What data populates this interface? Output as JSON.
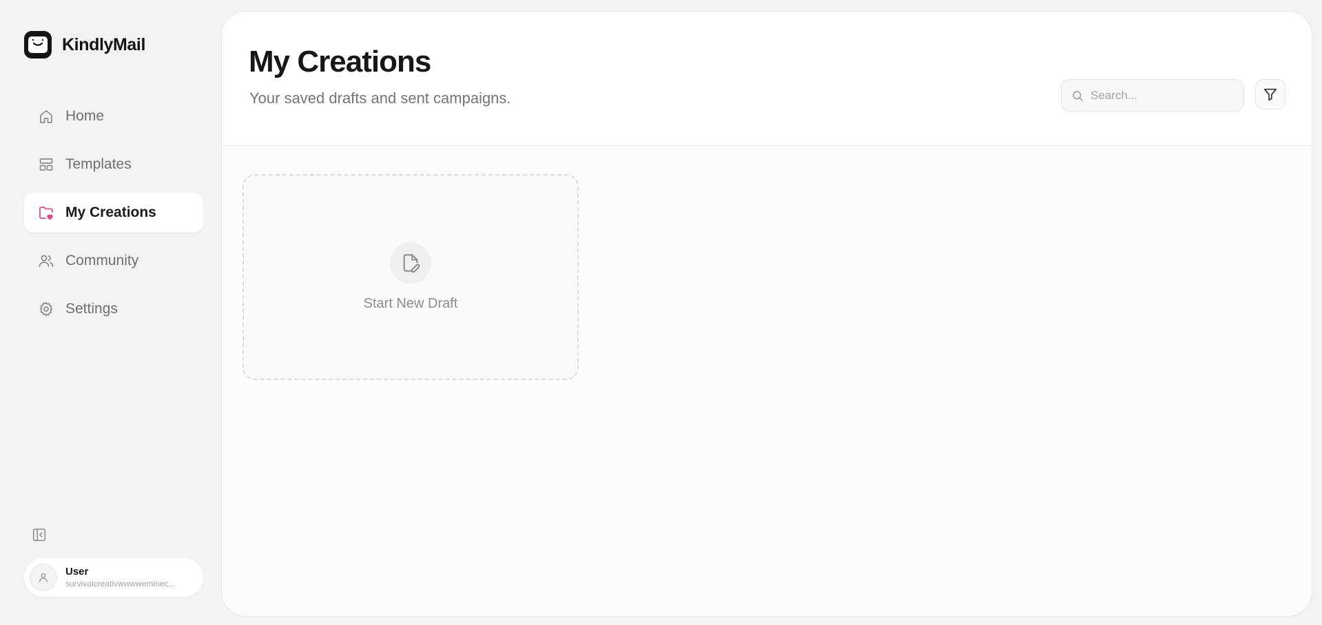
{
  "brand": {
    "name": "KindlyMail"
  },
  "nav": {
    "items": [
      {
        "label": "Home",
        "icon": "home-icon",
        "active": false
      },
      {
        "label": "Templates",
        "icon": "layout-icon",
        "active": false
      },
      {
        "label": "My Creations",
        "icon": "folder-heart-icon",
        "active": true
      },
      {
        "label": "Community",
        "icon": "users-icon",
        "active": false
      },
      {
        "label": "Settings",
        "icon": "gear-icon",
        "active": false
      }
    ]
  },
  "user": {
    "name": "User",
    "email": "survivalcreativwwwweminec..."
  },
  "header": {
    "title": "My Creations",
    "subtitle": "Your saved drafts and sent campaigns."
  },
  "search": {
    "placeholder": "Search...",
    "value": ""
  },
  "content": {
    "new_draft_label": "Start New Draft"
  },
  "colors": {
    "accent": "#e0468c",
    "background": "#f2f3f5",
    "panel": "#ffffff"
  }
}
